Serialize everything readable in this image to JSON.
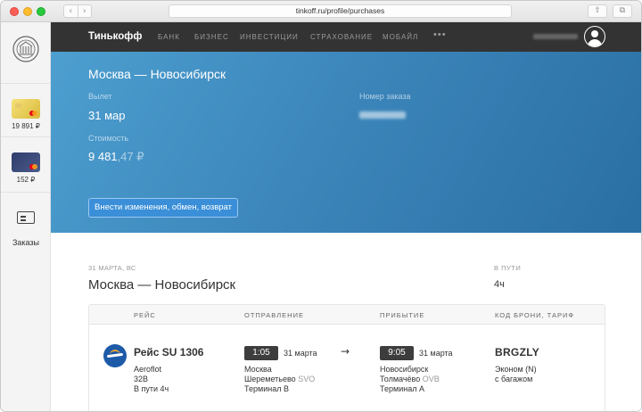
{
  "browser": {
    "url": "tinkoff.ru/profile/purchases",
    "back_icon": "‹",
    "forward_icon": "›",
    "share_icon": "⇧",
    "tabs_icon": "⧉"
  },
  "sidebar": {
    "cards": [
      {
        "amount": "19 891 ₽",
        "color": "#e8c84a"
      },
      {
        "amount": "152 ₽",
        "color": "#35426f"
      }
    ],
    "orders_label": "Заказы"
  },
  "topnav": {
    "brand": "Тинькофф",
    "links": [
      "БАНК",
      "БИЗНЕС",
      "ИНВЕСТИЦИИ",
      "СТРАХОВАНИЕ",
      "МОБАЙЛ"
    ],
    "more": "•••"
  },
  "hero": {
    "route": "Москва — Новосибирск",
    "departure_label": "Вылет",
    "departure_value": "31 мар",
    "order_label": "Номер заказа",
    "cost_label": "Стоимость",
    "cost_main": "9 481",
    "cost_kop": ",47 ₽",
    "action_button": "Внести изменения, обмен, возврат",
    "colors": {
      "start": "#4d9fd0",
      "end": "#2a6fa3"
    }
  },
  "itinerary": {
    "date_label": "31 МАРТА, ВС",
    "route": "Москва — Новосибирск",
    "transit_label": "В ПУТИ",
    "transit_value": "4ч",
    "headers": {
      "flight": "РЕЙС",
      "departure": "ОТПРАВЛЕНИЕ",
      "arrival": "ПРИБЫТИЕ",
      "booking": "КОД БРОНИ, ТАРИФ"
    },
    "flight": {
      "name": "Рейс SU 1306",
      "airline": "Aeroflot",
      "aircraft": "32B",
      "duration": "В пути 4ч"
    },
    "departure": {
      "time": "1:05",
      "date": "31 марта",
      "city": "Москва",
      "airport": "Шереметьево",
      "code": "SVO",
      "terminal": "Терминал B"
    },
    "arrow": "→",
    "arrival": {
      "time": "9:05",
      "date": "31 марта",
      "city": "Новосибирск",
      "airport": "Толмачёво",
      "code": "OVB",
      "terminal": "Терминал A"
    },
    "booking": {
      "code": "BRGZLY",
      "fare": "Эконом (N)",
      "baggage": "с багажом"
    }
  }
}
